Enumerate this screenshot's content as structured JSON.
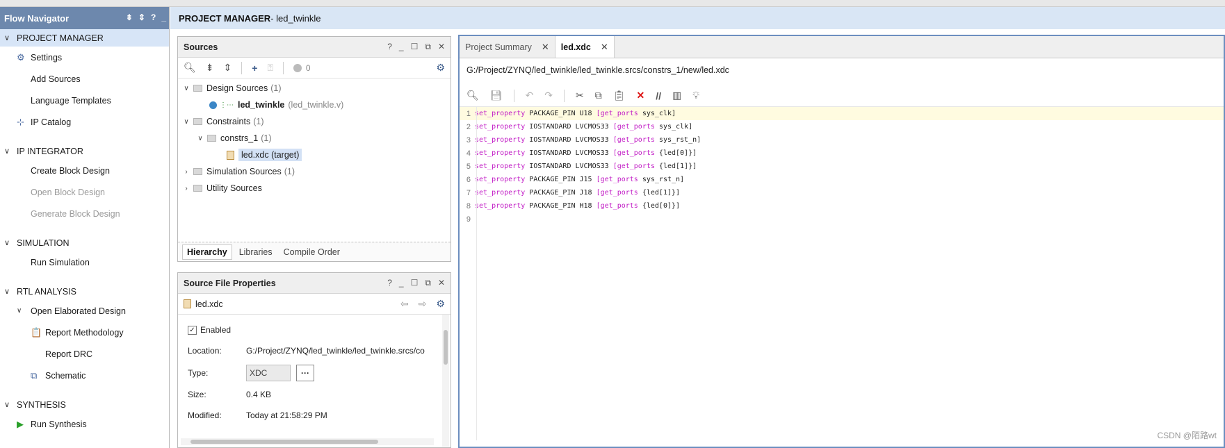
{
  "flow_navigator": {
    "title": "Flow Navigator",
    "sections": {
      "project_manager": {
        "label": "PROJECT MANAGER",
        "items": [
          "Settings",
          "Add Sources",
          "Language Templates",
          "IP Catalog"
        ]
      },
      "ip_integrator": {
        "label": "IP INTEGRATOR",
        "items": [
          "Create Block Design",
          "Open Block Design",
          "Generate Block Design"
        ]
      },
      "simulation": {
        "label": "SIMULATION",
        "items": [
          "Run Simulation"
        ]
      },
      "rtl_analysis": {
        "label": "RTL ANALYSIS",
        "open_elaborated": "Open Elaborated Design",
        "items": [
          "Report Methodology",
          "Report DRC",
          "Schematic"
        ]
      },
      "synthesis": {
        "label": "SYNTHESIS",
        "items": [
          "Run Synthesis"
        ]
      }
    }
  },
  "header": {
    "prefix": "PROJECT MANAGER",
    "suffix": " - led_twinkle"
  },
  "sources": {
    "title": "Sources",
    "status_count": "0",
    "tree": {
      "design_sources": {
        "label": "Design Sources",
        "count": "(1)"
      },
      "top_module": {
        "label": "led_twinkle",
        "file": "(led_twinkle.v)"
      },
      "constraints": {
        "label": "Constraints",
        "count": "(1)"
      },
      "constrs_1": {
        "label": "constrs_1",
        "count": "(1)"
      },
      "xdc_file": {
        "label": "led.xdc (target)"
      },
      "simulation_sources": {
        "label": "Simulation Sources",
        "count": "(1)"
      },
      "utility_sources": {
        "label": "Utility Sources"
      }
    },
    "tabs": [
      "Hierarchy",
      "Libraries",
      "Compile Order"
    ]
  },
  "source_file_properties": {
    "title": "Source File Properties",
    "file": "led.xdc",
    "enabled_label": "Enabled",
    "location_label": "Location:",
    "location_value": "G:/Project/ZYNQ/led_twinkle/led_twinkle.srcs/co",
    "type_label": "Type:",
    "type_value": "XDC",
    "size_label": "Size:",
    "size_value": "0.4 KB",
    "modified_label": "Modified:",
    "modified_value": "Today at 21:58:29 PM"
  },
  "editor": {
    "tabs": [
      {
        "label": "Project Summary"
      },
      {
        "label": "led.xdc"
      }
    ],
    "path": "G:/Project/ZYNQ/led_twinkle/led_twinkle.srcs/constrs_1/new/led.xdc",
    "lines": [
      {
        "n": "1",
        "a": "set_property",
        "b": " PACKAGE_PIN U18 ",
        "c": "[get_ports",
        "d": " sys_clk]"
      },
      {
        "n": "2",
        "a": "set_property",
        "b": " IOSTANDARD LVCMOS33 ",
        "c": "[get_ports",
        "d": " sys_clk]"
      },
      {
        "n": "3",
        "a": "set_property",
        "b": " IOSTANDARD LVCMOS33 ",
        "c": "[get_ports",
        "d": " sys_rst_n]"
      },
      {
        "n": "4",
        "a": "set_property",
        "b": " IOSTANDARD LVCMOS33 ",
        "c": "[get_ports",
        "d": " {led[0]}]"
      },
      {
        "n": "5",
        "a": "set_property",
        "b": " IOSTANDARD LVCMOS33 ",
        "c": "[get_ports",
        "d": " {led[1]}]"
      },
      {
        "n": "6",
        "a": "set_property",
        "b": " PACKAGE_PIN J15 ",
        "c": "[get_ports",
        "d": " sys_rst_n]"
      },
      {
        "n": "7",
        "a": "set_property",
        "b": " PACKAGE_PIN J18 ",
        "c": "[get_ports",
        "d": " {led[1]}]"
      },
      {
        "n": "8",
        "a": "set_property",
        "b": " PACKAGE_PIN H18 ",
        "c": "[get_ports",
        "d": " {led[0]}]"
      },
      {
        "n": "9",
        "a": "",
        "b": "",
        "c": "",
        "d": ""
      }
    ]
  },
  "watermark": "CSDN @陌路wt",
  "colors": {
    "nav_header": "#6d88ad",
    "selection": "#d7e5f7",
    "keyword": "#c21dc6",
    "editor_border": "#6c8ebf"
  }
}
